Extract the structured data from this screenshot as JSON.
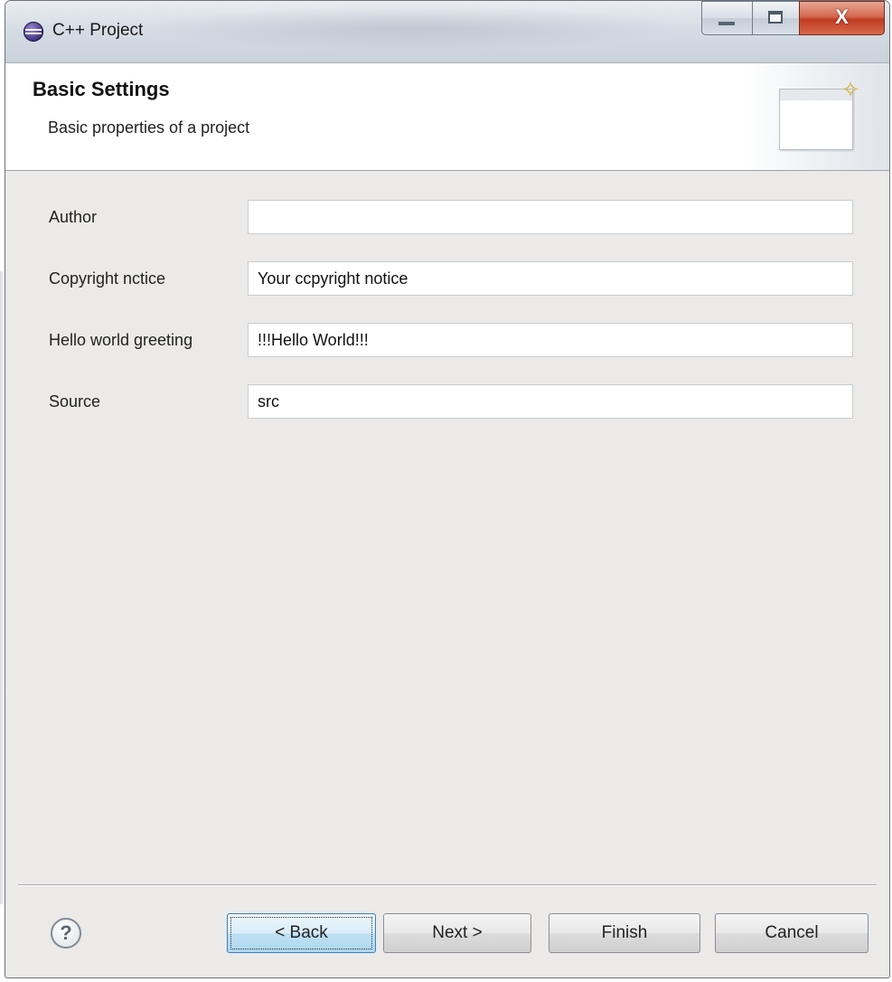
{
  "window": {
    "title": "C++ Project",
    "min_icon": "minimize-icon",
    "max_icon": "maximize-icon",
    "close_icon": "close-icon",
    "close_glyph": "X"
  },
  "banner": {
    "title": "Basic Settings",
    "subtitle": "Basic properties of a project",
    "icon": "new-project-wizard-icon"
  },
  "form": {
    "fields": [
      {
        "label": "Author",
        "value": "",
        "placeholder": ""
      },
      {
        "label": "Copyright nctice",
        "value": "Your ccpyright notice",
        "placeholder": ""
      },
      {
        "label": "Hello world greeting",
        "value": "!!!Hello World!!!",
        "placeholder": ""
      },
      {
        "label": "Source",
        "value": "src",
        "placeholder": ""
      }
    ]
  },
  "footer": {
    "help_glyph": "?",
    "back_label": "< Back",
    "next_label": "Next >",
    "finish_label": "Finish",
    "cancel_label": "Cancel"
  },
  "colors": {
    "dialog_bg": "#ebeae8",
    "banner_bg": "#ffffff",
    "close_button": "#c03b22",
    "focused_button": "#3b7fc4"
  }
}
